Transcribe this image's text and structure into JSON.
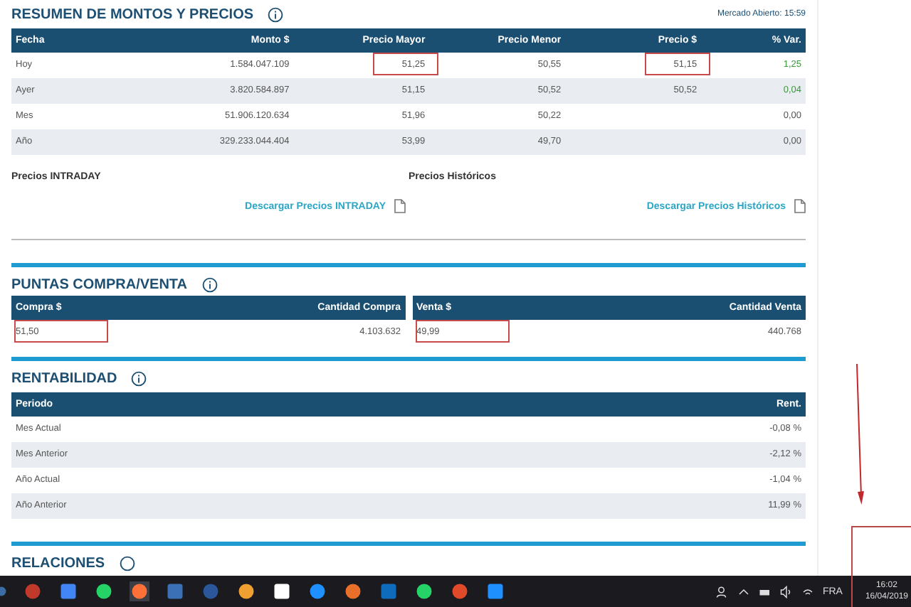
{
  "resumen": {
    "title": "RESUMEN DE MONTOS Y PRECIOS",
    "status": "Mercado Abierto: 15:59",
    "columns": [
      "Fecha",
      "Monto $",
      "Precio Mayor",
      "Precio Menor",
      "Precio $",
      "% Var."
    ],
    "rows": [
      {
        "var_up": true,
        "cells": [
          {
            "text": "Hoy",
            "boxed": false
          },
          {
            "text": "1.584.047.109",
            "boxed": false
          },
          {
            "text": "51,25",
            "boxed": true
          },
          {
            "text": "50,55",
            "boxed": false
          },
          {
            "text": "51,15",
            "boxed": true
          },
          {
            "text": "1,25",
            "boxed": false
          }
        ]
      },
      {
        "var_up": true,
        "cells": [
          {
            "text": "Ayer",
            "boxed": false
          },
          {
            "text": "3.820.584.897",
            "boxed": false
          },
          {
            "text": "51,15",
            "boxed": false
          },
          {
            "text": "50,52",
            "boxed": false
          },
          {
            "text": "50,52",
            "boxed": false
          },
          {
            "text": "0,04",
            "boxed": false
          }
        ]
      },
      {
        "var_up": false,
        "cells": [
          {
            "text": "Mes",
            "boxed": false
          },
          {
            "text": "51.906.120.634",
            "boxed": false
          },
          {
            "text": "51,96",
            "boxed": false
          },
          {
            "text": "50,22",
            "boxed": false
          },
          {
            "boxed": false
          },
          {
            "text": "0,00",
            "boxed": false
          }
        ]
      },
      {
        "var_up": false,
        "cells": [
          {
            "text": "Año",
            "boxed": false
          },
          {
            "text": "329.233.044.404",
            "boxed": false
          },
          {
            "text": "53,99",
            "boxed": false
          },
          {
            "text": "49,70",
            "boxed": false
          },
          {
            "boxed": false
          },
          {
            "text": "0,00",
            "boxed": false
          }
        ]
      }
    ],
    "downloads": [
      {
        "label": "Precios INTRADAY",
        "link": "Descargar Precios INTRADAY"
      },
      {
        "label": "Precios Históricos",
        "link": "Descargar Precios Históricos"
      }
    ]
  },
  "puntas": {
    "title": "PUNTAS COMPRA/VENTA",
    "sides": [
      {
        "columns": [
          "Compra $",
          "Cantidad Compra"
        ],
        "price": "51,50",
        "quantity": "4.103.632",
        "boxed": true
      },
      {
        "columns": [
          "Venta $",
          "Cantidad Venta"
        ],
        "price": "49,99",
        "quantity": "440.768",
        "boxed": true
      }
    ]
  },
  "rentabilidad": {
    "title": "RENTABILIDAD",
    "columns": [
      "Periodo",
      "Rent."
    ],
    "rows": [
      {
        "period": "Mes Actual",
        "value": "-0,08 %"
      },
      {
        "period": "Mes Anterior",
        "value": "-2,12 %"
      },
      {
        "period": "Año Actual",
        "value": "-1,04 %"
      },
      {
        "period": "Año Anterior",
        "value": "11,99 %"
      }
    ]
  },
  "relaciones": {
    "title": "RELACIONES"
  },
  "taskbar": {
    "language": "FRA",
    "time": "16:02",
    "date": "16/04/2019"
  }
}
